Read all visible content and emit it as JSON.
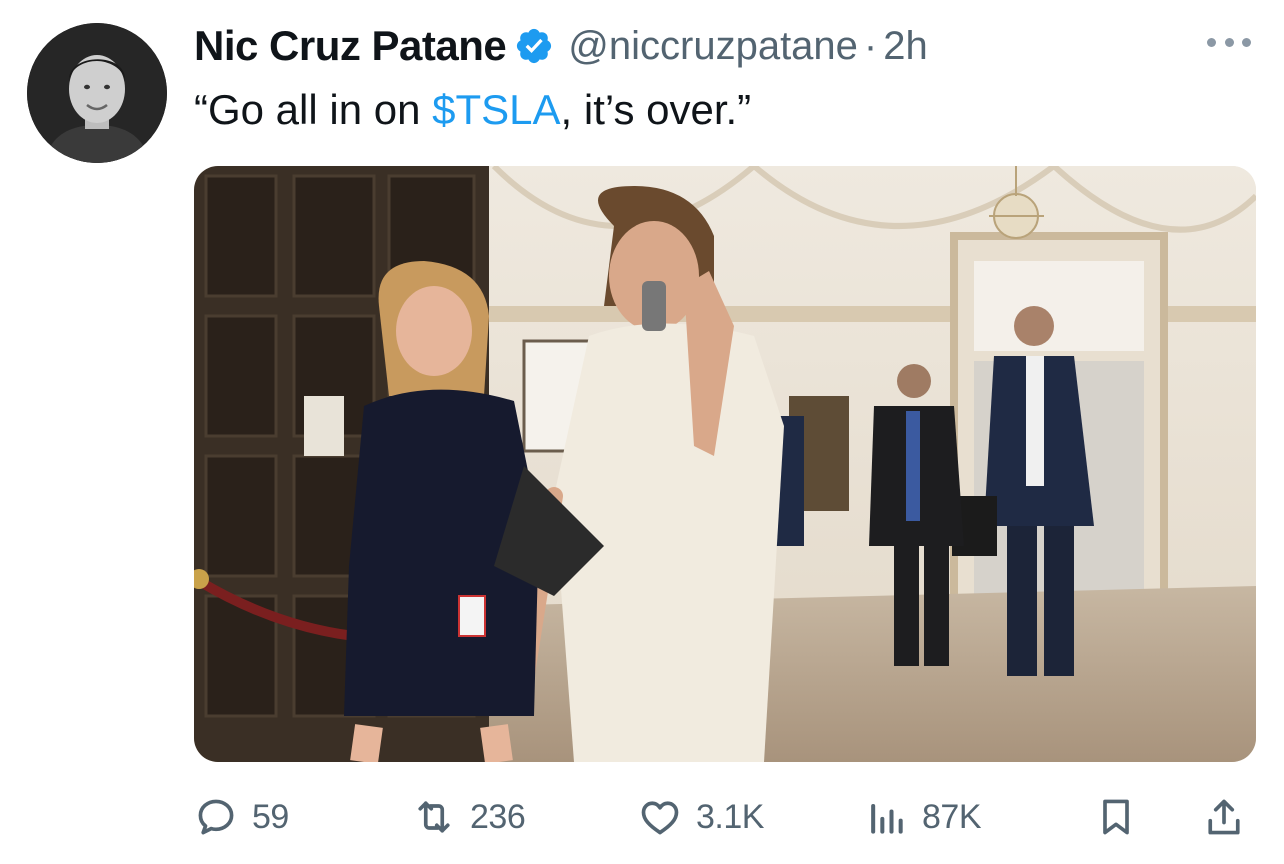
{
  "author": {
    "name": "Nic Cruz Patane",
    "handle": "@niccruzpatane",
    "separator": "·",
    "time": "2h",
    "verified": true,
    "avatar_icon": "avatar-photo"
  },
  "tweet": {
    "text_before": "“Go all in on ",
    "cashtag": "$TSLA",
    "text_after": ", it’s over.”"
  },
  "media": {
    "type": "photo",
    "icon": "photo-media"
  },
  "actions": {
    "replies": "59",
    "retweets": "236",
    "likes": "3.1K",
    "views": "87K"
  },
  "colors": {
    "accent": "#1d9bf0",
    "secondary_text": "#536471",
    "primary_text": "#0f1419"
  }
}
